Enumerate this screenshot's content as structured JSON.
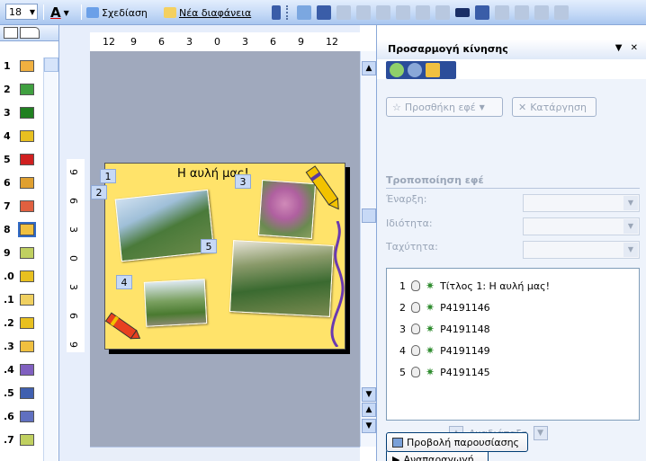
{
  "toolbar": {
    "font_size": "18",
    "design_label": "Σχεδίαση",
    "new_slide_label": "Νέα διαφάνεια"
  },
  "thumbnails": {
    "items": [
      {
        "num": "1",
        "color": "#f0b040"
      },
      {
        "num": "2",
        "color": "#40a040"
      },
      {
        "num": "3",
        "color": "#208020"
      },
      {
        "num": "4",
        "color": "#e8c020"
      },
      {
        "num": "5",
        "color": "#d02020"
      },
      {
        "num": "6",
        "color": "#e0a030"
      },
      {
        "num": "7",
        "color": "#e06040"
      },
      {
        "num": "8",
        "color": "#f0c040"
      },
      {
        "num": "9",
        "color": "#c0d060"
      },
      {
        "num": ".0",
        "color": "#e8c020"
      },
      {
        "num": ".1",
        "color": "#f0d060"
      },
      {
        "num": ".2",
        "color": "#e8c020"
      },
      {
        "num": ".3",
        "color": "#f0c040"
      },
      {
        "num": ".4",
        "color": "#8060c0"
      },
      {
        "num": ".5",
        "color": "#4060b0"
      },
      {
        "num": ".6",
        "color": "#6070c0"
      },
      {
        "num": ".7",
        "color": "#c0d060"
      }
    ],
    "selected_index": 7
  },
  "ruler": {
    "h_ticks": [
      "12",
      "9",
      "6",
      "3",
      "0",
      "3",
      "6",
      "9",
      "12"
    ],
    "v_ticks": [
      "9",
      "6",
      "3",
      "0",
      "3",
      "6",
      "9"
    ]
  },
  "slide": {
    "title": "Η αυλή μας!",
    "tags": [
      "1",
      "2",
      "3",
      "4",
      "5"
    ]
  },
  "pane": {
    "title": "Προσαρμογή κίνησης",
    "add_effect": "Προσθήκη εφέ",
    "remove": "Κατάργηση",
    "modify_section": "Τροποποίηση εφέ",
    "start_label": "Έναρξη:",
    "property_label": "Ιδιότητα:",
    "speed_label": "Ταχύτητα:",
    "animations": [
      {
        "num": "1",
        "label": "Τίτλος 1: Η αυλή μας!"
      },
      {
        "num": "2",
        "label": "P4191146"
      },
      {
        "num": "3",
        "label": "P4191148"
      },
      {
        "num": "4",
        "label": "P4191149"
      },
      {
        "num": "5",
        "label": "P4191145"
      }
    ],
    "reorder_label": "Αναδιάταξη",
    "play_label": "Αναπαραγωγή",
    "slideshow_label": "Προβολή παρουσίασης"
  }
}
